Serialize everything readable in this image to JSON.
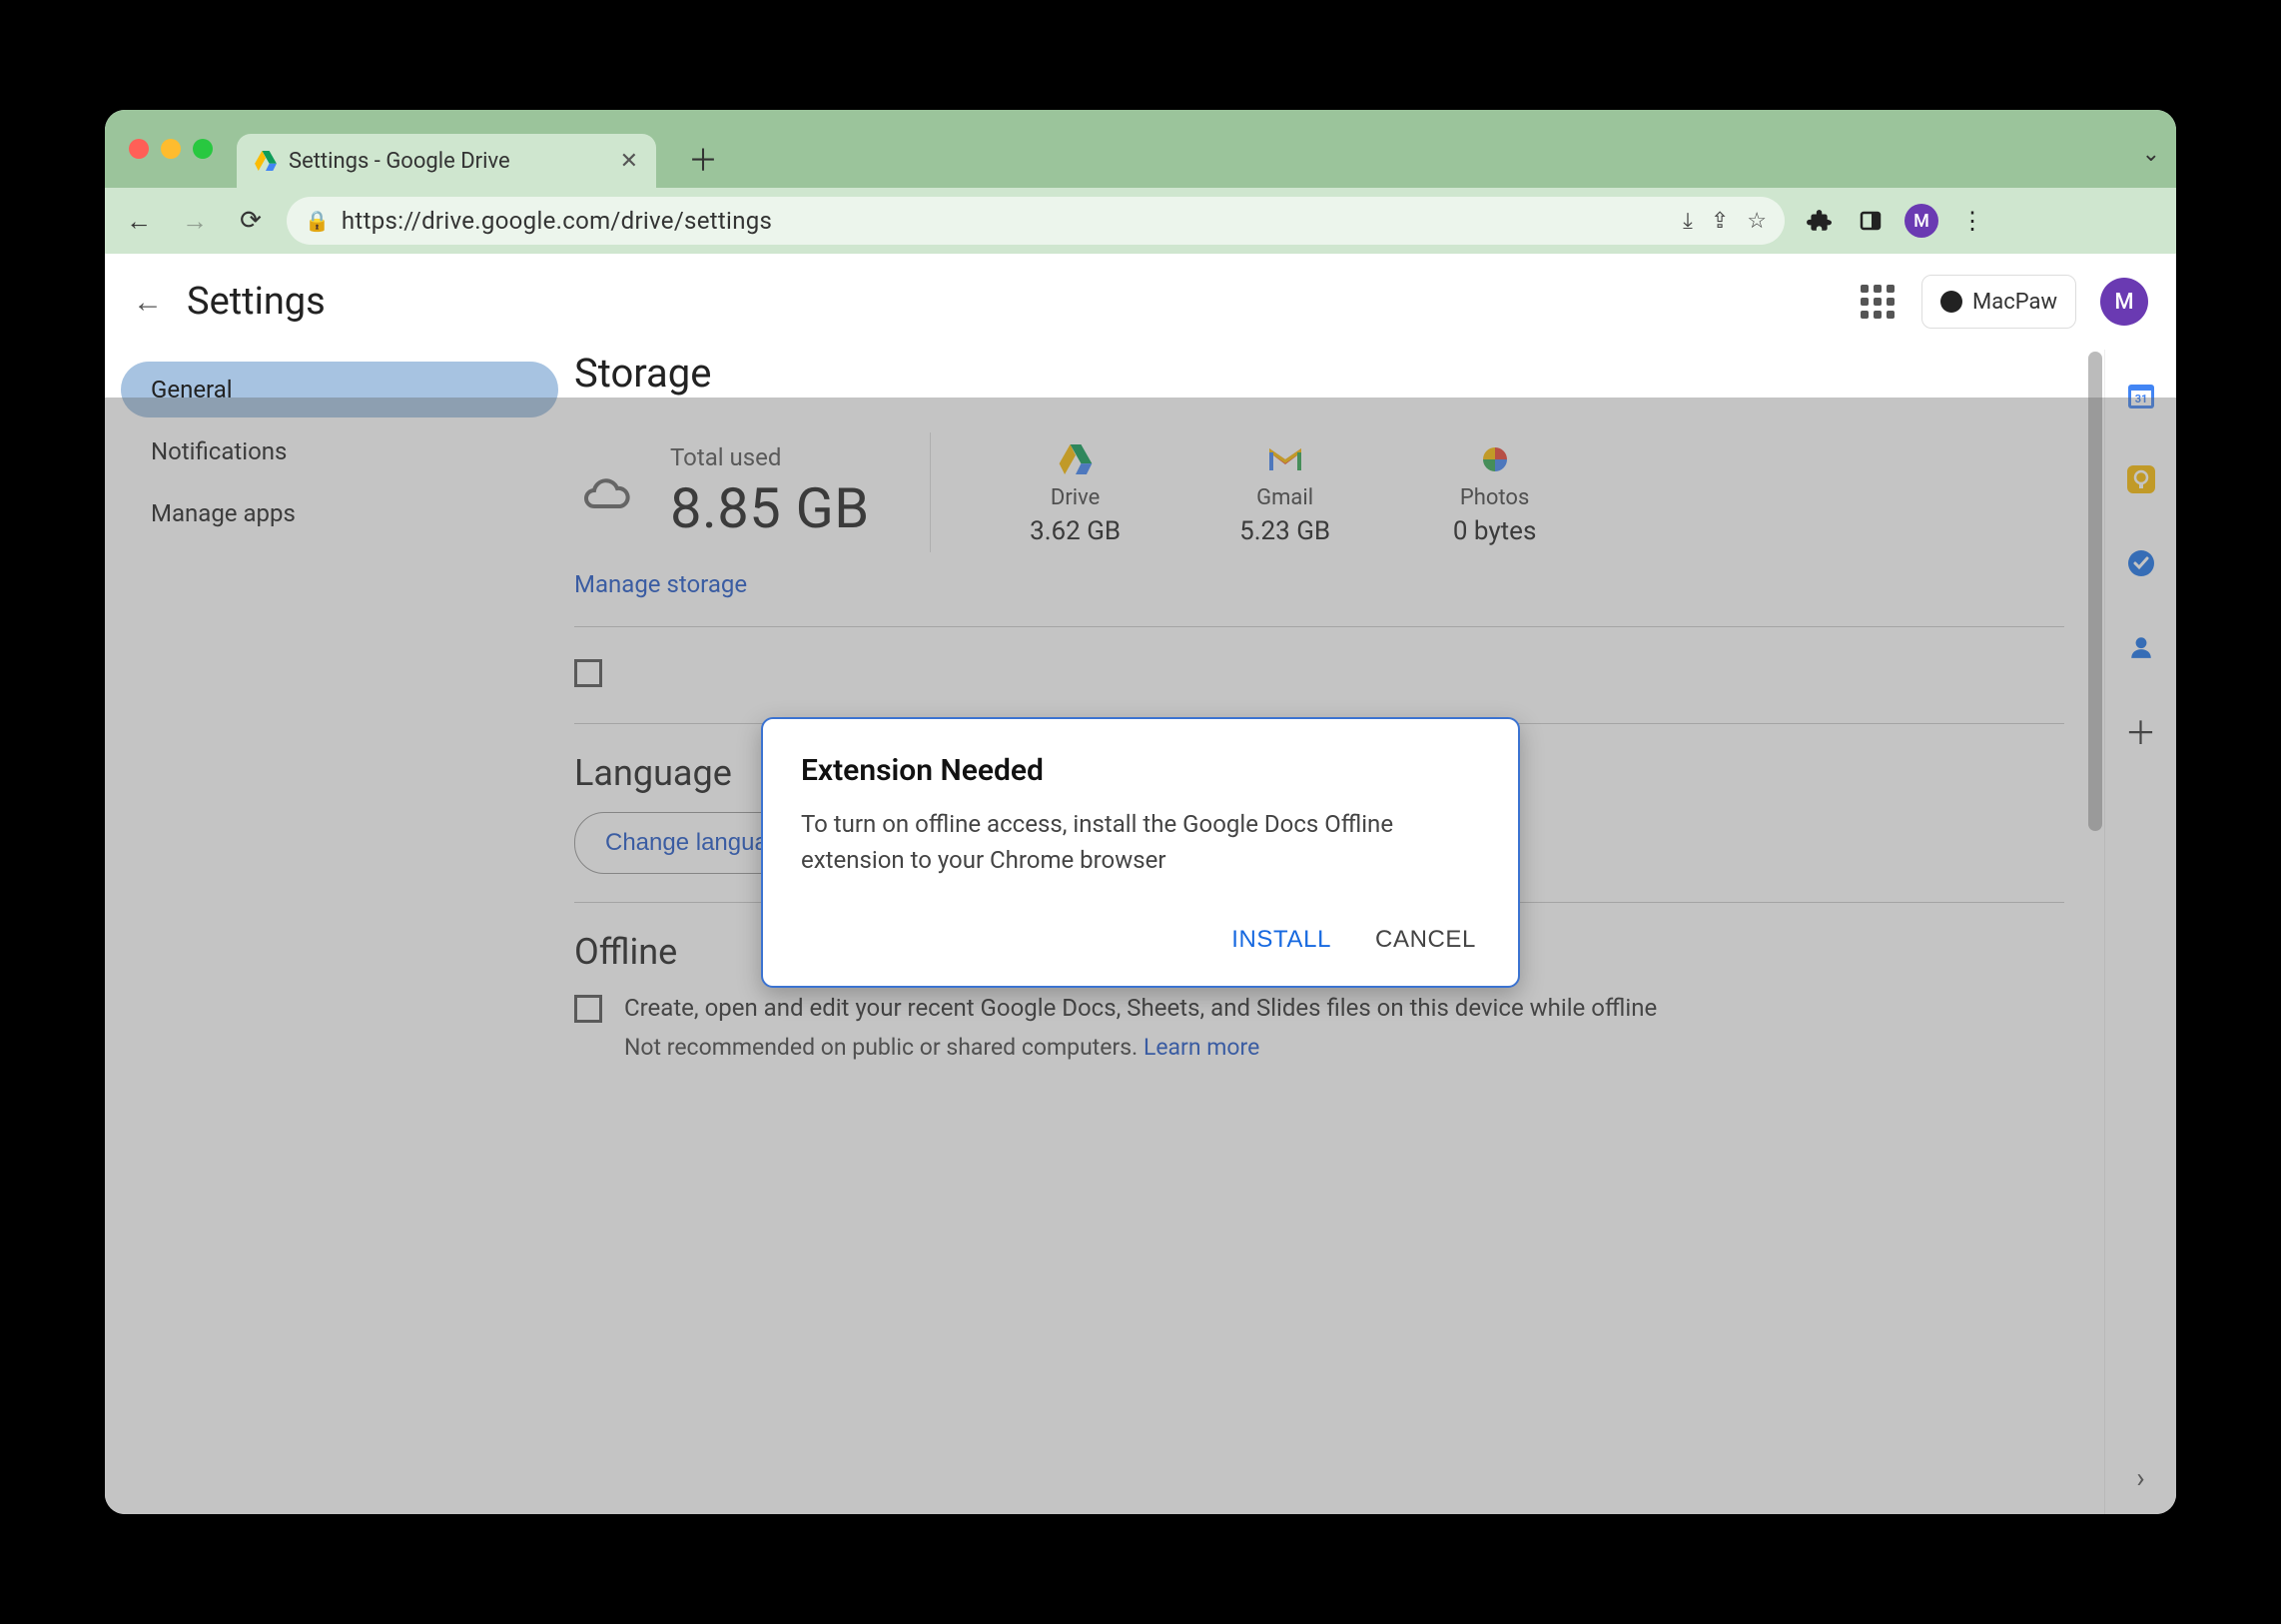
{
  "browser": {
    "tab_title": "Settings - Google Drive",
    "url": "https://drive.google.com/drive/settings",
    "profile_initial": "M"
  },
  "header": {
    "title": "Settings",
    "org_button": "MacPaw",
    "avatar_initial": "M"
  },
  "sidebar": {
    "items": [
      "General",
      "Notifications",
      "Manage apps"
    ],
    "active_index": 0
  },
  "storage": {
    "heading": "Storage",
    "total_label": "Total used",
    "total_value": "8.85 GB",
    "services": [
      {
        "name": "Drive",
        "value": "3.62 GB"
      },
      {
        "name": "Gmail",
        "value": "5.23 GB"
      },
      {
        "name": "Photos",
        "value": "0 bytes"
      }
    ],
    "manage_link": "Manage storage"
  },
  "language": {
    "heading": "Language",
    "button": "Change language settings"
  },
  "offline": {
    "heading": "Offline",
    "checkbox_label": "Create, open and edit your recent Google Docs, Sheets, and Slides files on this device while offline",
    "note_prefix": "Not recommended on public or shared computers. ",
    "learn_more": "Learn more"
  },
  "modal": {
    "title": "Extension Needed",
    "body": "To turn on offline access, install the Google Docs Offline extension to your Chrome browser",
    "install": "INSTALL",
    "cancel": "CANCEL"
  }
}
